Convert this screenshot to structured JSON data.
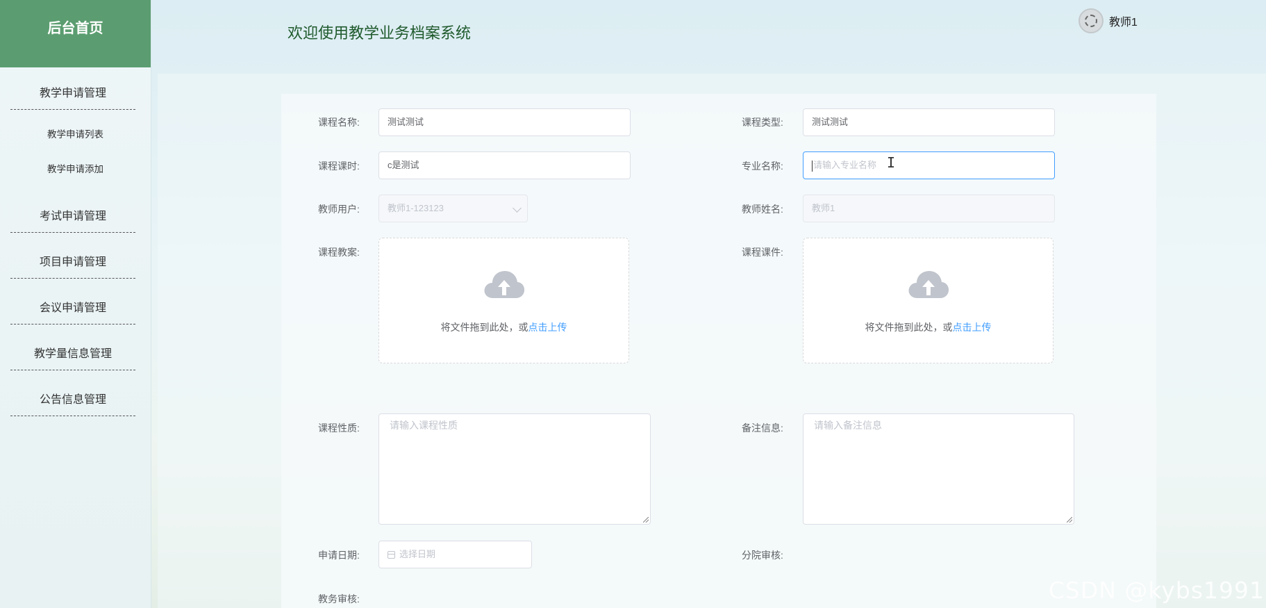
{
  "sidebar": {
    "brand": "后台首页",
    "groups": [
      {
        "title": "教学申请管理",
        "items": [
          "教学申请列表",
          "教学申请添加"
        ]
      },
      {
        "title": "考试申请管理"
      },
      {
        "title": "项目申请管理"
      },
      {
        "title": "会议申请管理"
      },
      {
        "title": "教学量信息管理"
      },
      {
        "title": "公告信息管理"
      }
    ]
  },
  "header": {
    "welcome": "欢迎使用教学业务档案系统",
    "username": "教师1"
  },
  "form": {
    "course_name": {
      "label": "课程名称:",
      "value": "测试测试"
    },
    "course_type": {
      "label": "课程类型:",
      "value": "测试测试"
    },
    "course_hours": {
      "label": "课程课时:",
      "value": "c是测试"
    },
    "major_name": {
      "label": "专业名称:",
      "placeholder": "请输入专业名称"
    },
    "teacher_user": {
      "label": "教师用户:",
      "value": "教师1-123123"
    },
    "teacher_name": {
      "label": "教师姓名:",
      "value": "教师1"
    },
    "lesson_plan": {
      "label": "课程教案:"
    },
    "courseware": {
      "label": "课程课件:"
    },
    "upload": {
      "text": "将文件拖到此处，或",
      "link": "点击上传"
    },
    "course_nature": {
      "label": "课程性质:",
      "placeholder": "请输入课程性质"
    },
    "remarks": {
      "label": "备注信息:",
      "placeholder": "请输入备注信息"
    },
    "apply_date": {
      "label": "申请日期:",
      "placeholder": "选择日期"
    },
    "branch_review": {
      "label": "分院审核:"
    },
    "academic_review": {
      "label": "教务审核:"
    }
  },
  "watermark": "CSDN @kybs1991",
  "colors": {
    "brand_bg": "#5b9d70",
    "accent": "#409eff"
  }
}
